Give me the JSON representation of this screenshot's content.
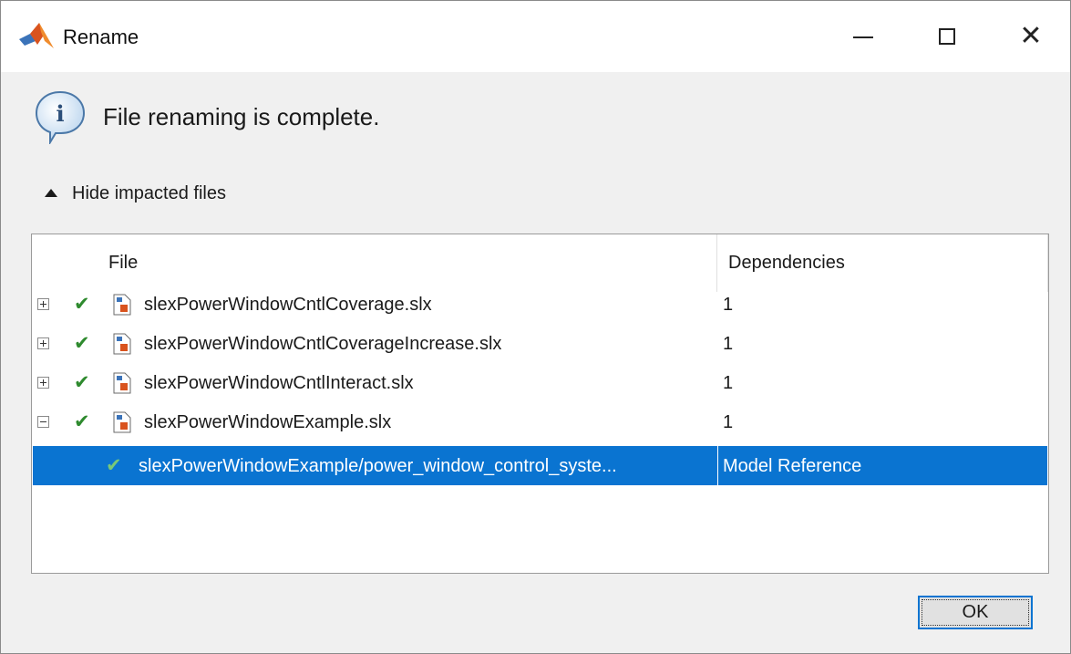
{
  "window": {
    "title": "Rename",
    "controls": {
      "minimize": "minimize",
      "maximize": "maximize",
      "close": "✕"
    }
  },
  "message": "File renaming is complete.",
  "toggle": {
    "label": "Hide impacted files"
  },
  "table": {
    "columns": [
      "File",
      "Dependencies"
    ],
    "rows": [
      {
        "name": "slexPowerWindowCntlCoverage.slx",
        "dependencies": "1",
        "expander": "plus"
      },
      {
        "name": "slexPowerWindowCntlCoverageIncrease.slx",
        "dependencies": "1",
        "expander": "plus"
      },
      {
        "name": "slexPowerWindowCntlInteract.slx",
        "dependencies": "1",
        "expander": "plus"
      },
      {
        "name": "slexPowerWindowExample.slx",
        "dependencies": "1",
        "expander": "minus"
      }
    ],
    "child_row": {
      "name": "slexPowerWindowExample/power_window_control_syste...",
      "dependencies": "Model Reference",
      "selected": true
    },
    "check_glyph": "✔"
  },
  "buttons": {
    "ok": "OK"
  },
  "colors": {
    "selection": "#0a74d1",
    "check": "#2e8a2e",
    "dialog_bg": "#f0f0f0"
  }
}
